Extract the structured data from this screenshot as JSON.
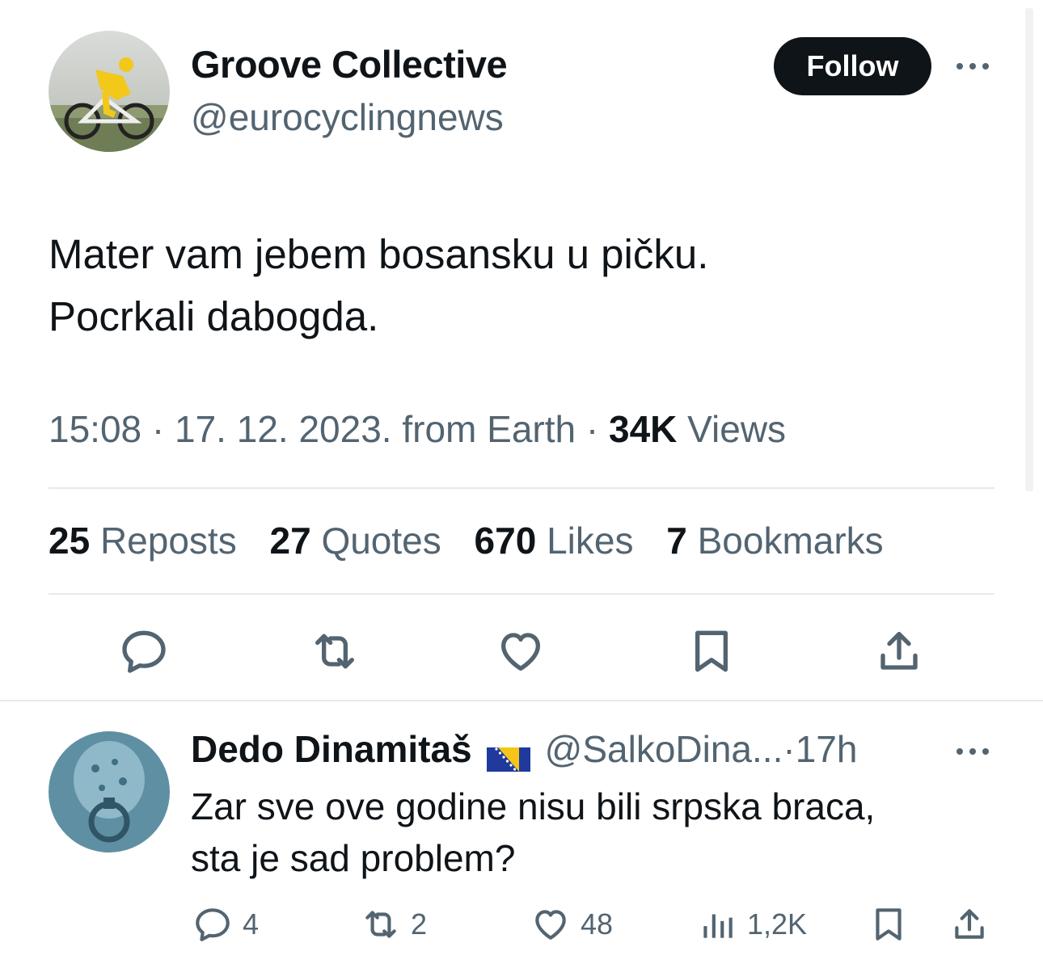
{
  "tweet": {
    "author_name": "Groove Collective",
    "author_handle": "@eurocyclingnews",
    "follow_label": "Follow",
    "text_lines": [
      "Mater vam jebem bosansku u pičku.",
      "Pocrkali dabogda."
    ],
    "time": "15:08",
    "date": "17. 12. 2023.",
    "source": "from Earth",
    "separator": "·",
    "views_count": "34K",
    "views_label": "Views",
    "stats": [
      {
        "count": "25",
        "label": "Reposts"
      },
      {
        "count": "27",
        "label": "Quotes"
      },
      {
        "count": "670",
        "label": "Likes"
      },
      {
        "count": "7",
        "label": "Bookmarks"
      }
    ]
  },
  "reply": {
    "author_name": "Dedo Dinamitaš",
    "author_handle": "@SalkoDina...",
    "separator": "·",
    "time": "17h",
    "text_lines": [
      "Zar sve ove godine nisu bili srpska braca,",
      "sta je sad problem?"
    ],
    "replies": "4",
    "reposts": "2",
    "likes": "48",
    "views": "1,2K"
  },
  "icons": {
    "more": "more-dots-icon",
    "reply": "reply-bubble-icon",
    "repost": "repost-arrows-icon",
    "like": "heart-icon",
    "bookmark": "bookmark-icon",
    "share": "share-upload-icon",
    "views": "views-bars-icon",
    "flag": "bosnia-flag-icon"
  },
  "colors": {
    "text_primary": "#0f1419",
    "text_secondary": "#536471",
    "divider": "#e6e9ec",
    "follow_bg": "#0f1419",
    "follow_text": "#ffffff"
  }
}
